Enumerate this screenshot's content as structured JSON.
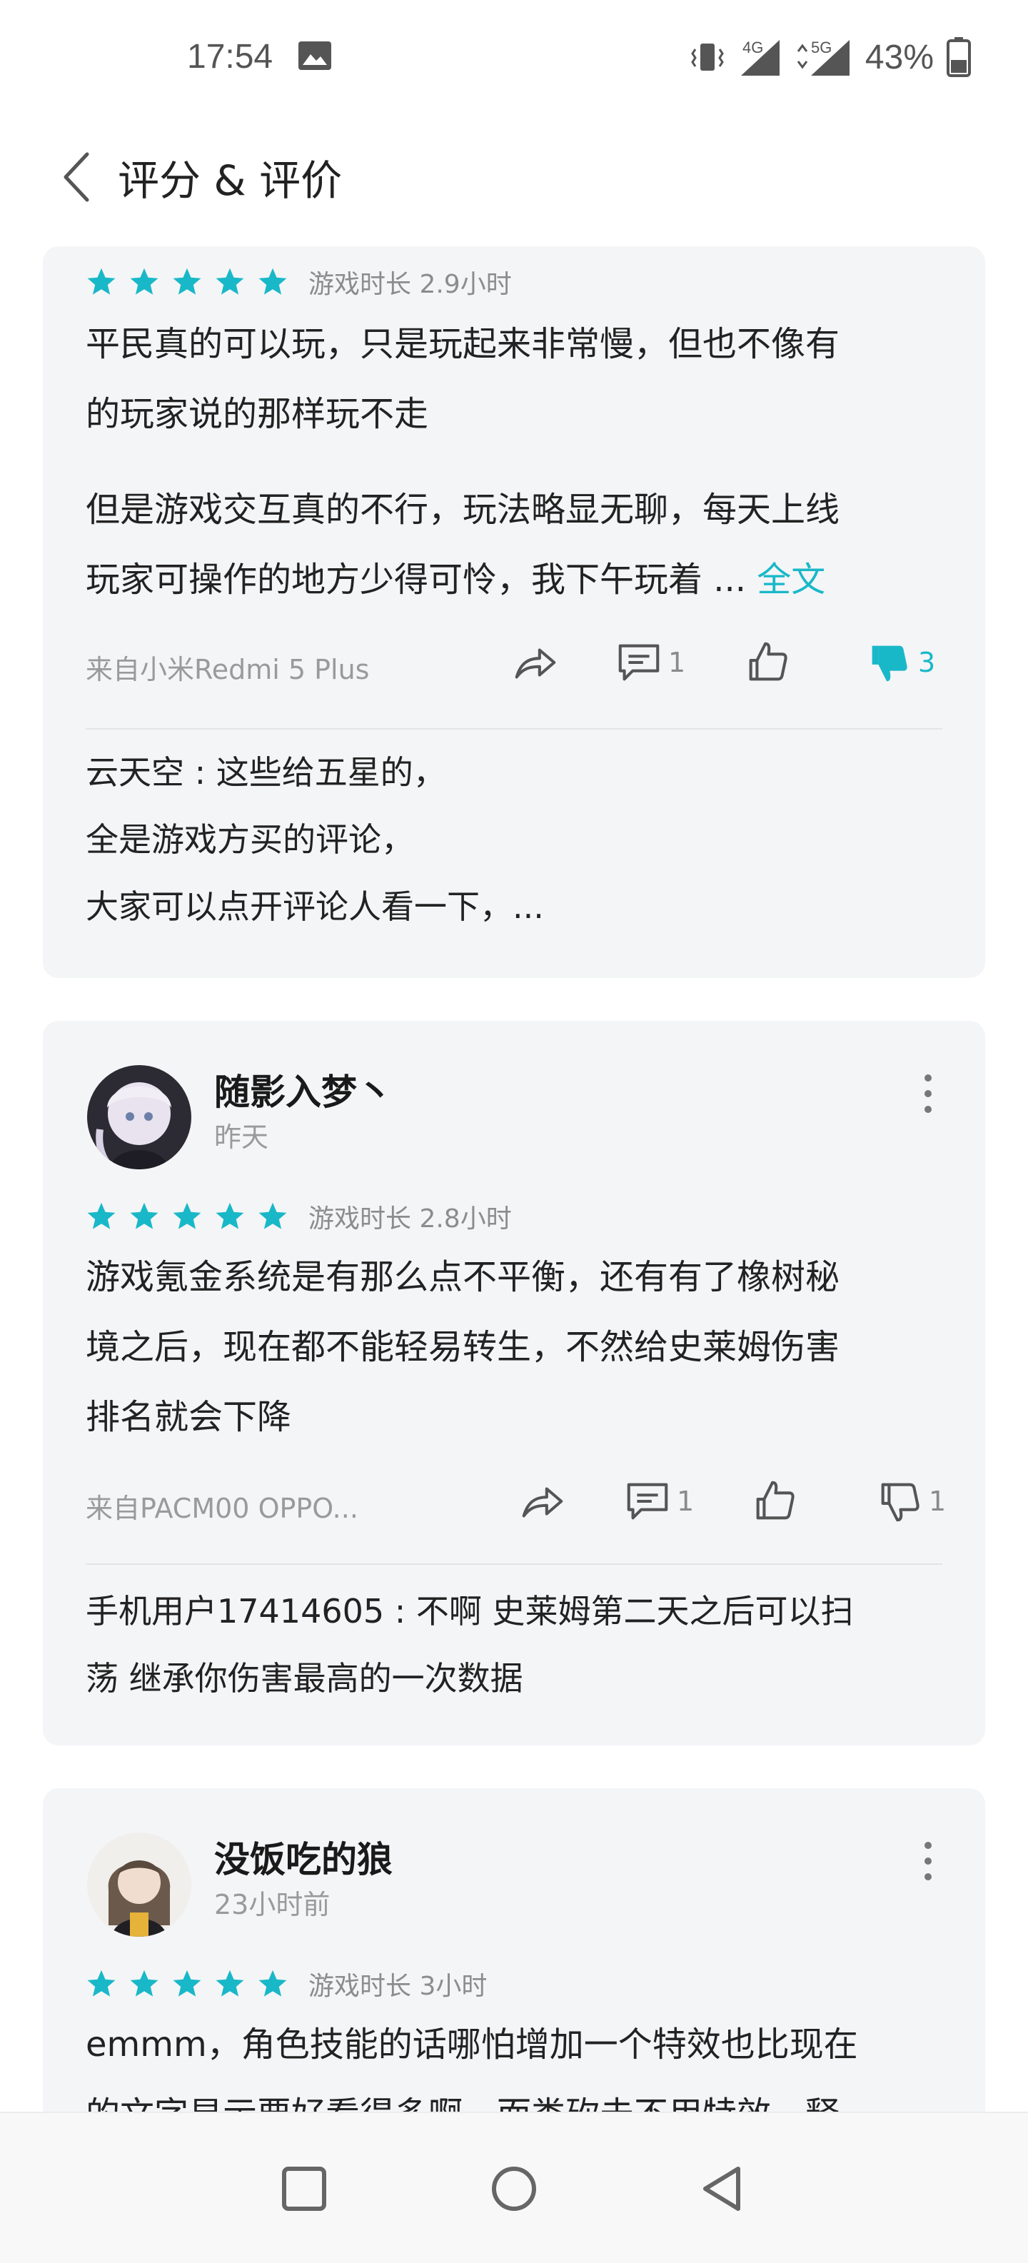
{
  "status": {
    "time": "17:54",
    "battery": "43%",
    "net1": "4G",
    "net2": "5G"
  },
  "header": {
    "title": "评分 & 评价"
  },
  "colors": {
    "accent": "#19b8c8",
    "card_bg": "#f4f5f7",
    "text": "#222222",
    "muted": "#9a9a9a"
  },
  "reviews": [
    {
      "rating": 5,
      "playtime": "游戏时长 2.9小时",
      "lines": [
        "平民真的可以玩，只是玩起来非常慢，但也不像有",
        "的玩家说的那样玩不走",
        "但是游戏交互真的不行，玩法略显无聊，每天上线",
        "玩家可操作的地方少得可怜，我下午玩着 ... "
      ],
      "full_link": "全文",
      "device": "来自小米Redmi 5 Plus",
      "comments": "1",
      "dislikes": "3",
      "reply_lines": [
        "云天空 : 这些给五星的，",
        "全是游戏方买的评论，",
        "大家可以点开评论人看一下，..."
      ]
    },
    {
      "user": "随影入梦丶",
      "time": "昨天",
      "rating": 5,
      "playtime": "游戏时长 2.8小时",
      "lines": [
        "游戏氪金系统是有那么点不平衡，还有有了橡树秘",
        "境之后，现在都不能轻易转生，不然给史莱姆伤害",
        "排名就会下降"
      ],
      "device": "来自PACM00 OPPO...",
      "comments": "1",
      "dislikes": "1",
      "reply_lines": [
        "手机用户17414605 : 不啊 史莱姆第二天之后可以扫",
        "荡 继承你伤害最高的一次数据"
      ]
    },
    {
      "user": "没饭吃的狼",
      "time": "23小时前",
      "rating": 5,
      "playtime": "游戏时长 3小时",
      "lines": [
        "emmm，角色技能的话哪怕增加一个特效也比现在",
        "的文字显示要好看得多啊，而类砍击不用特效，释"
      ]
    }
  ]
}
